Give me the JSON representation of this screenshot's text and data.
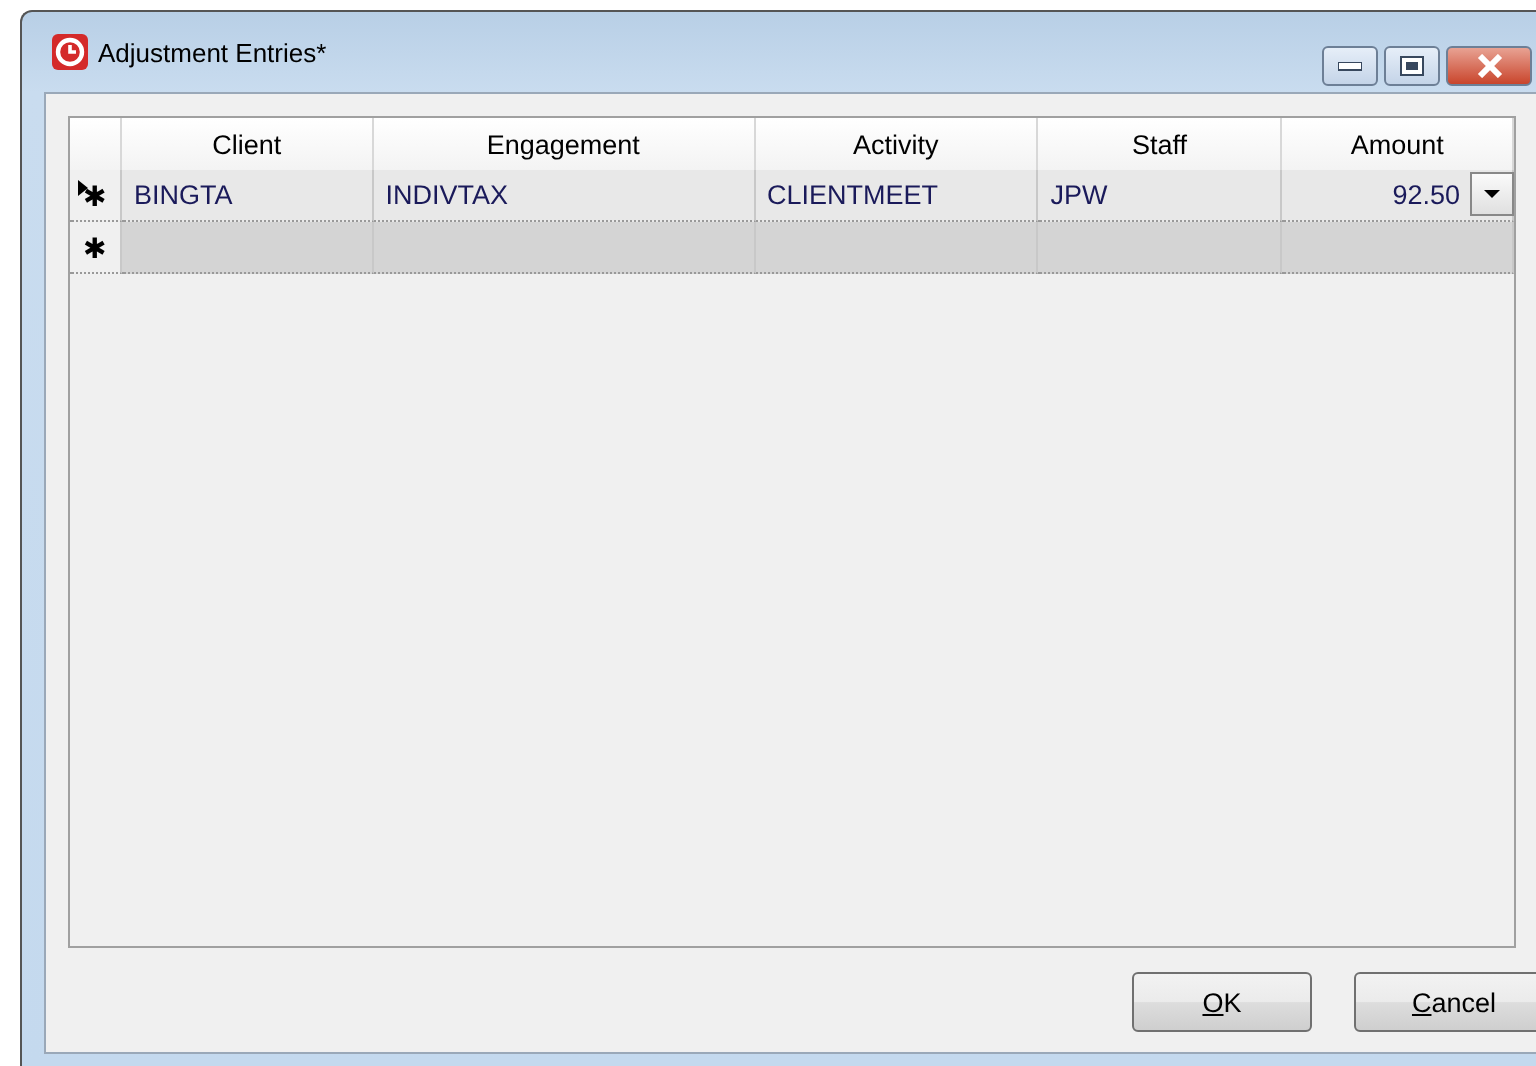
{
  "window": {
    "title": "Adjustment Entries*"
  },
  "table": {
    "columns": [
      "Client",
      "Engagement",
      "Activity",
      "Staff",
      "Amount"
    ],
    "rows": [
      {
        "marker": "✱",
        "current": true,
        "kind": "entry",
        "cells": [
          "BINGTA",
          "INDIVTAX",
          "CLIENTMEET",
          "JPW",
          "92.50"
        ],
        "dropdown": true
      },
      {
        "marker": "✱",
        "current": false,
        "kind": "new",
        "cells": [
          "",
          "",
          "",
          "",
          ""
        ],
        "dropdown": false
      }
    ]
  },
  "buttons": [
    {
      "access_key": "O",
      "label_rest": "K"
    },
    {
      "access_key": "C",
      "label_rest": "ancel"
    }
  ]
}
